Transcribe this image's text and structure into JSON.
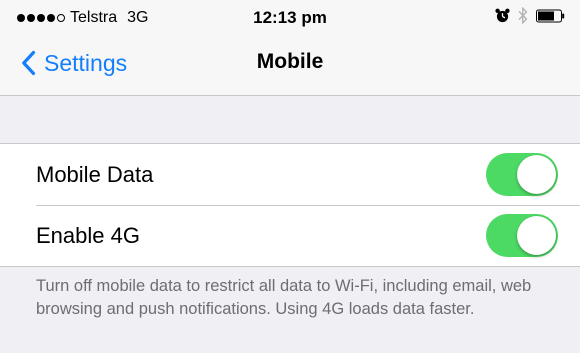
{
  "status_bar": {
    "carrier": "Telstra",
    "network": "3G",
    "time": "12:13 pm",
    "signal_bars_filled": 4,
    "signal_bars_total": 5,
    "icons": [
      "alarm-clock-icon",
      "bluetooth-icon",
      "battery-icon"
    ]
  },
  "nav": {
    "back_label": "Settings",
    "title": "Mobile"
  },
  "settings": {
    "rows": [
      {
        "label": "Mobile Data",
        "enabled": true
      },
      {
        "label": "Enable 4G",
        "enabled": true
      }
    ],
    "footer": "Turn off mobile data to restrict all data to Wi-Fi, including email, web browsing and push notifications. Using 4G loads data faster."
  },
  "colors": {
    "accent": "#157efb",
    "switch_on": "#4cd964",
    "background": "#efeff4",
    "footer_text": "#6d6d72"
  }
}
